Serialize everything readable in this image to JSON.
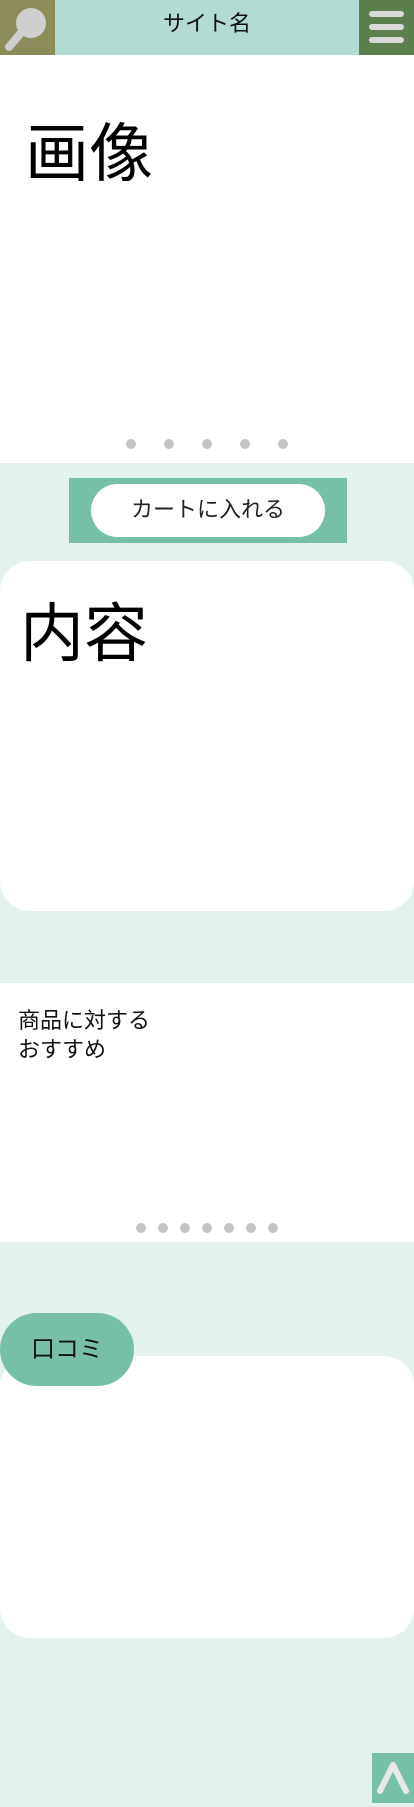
{
  "header": {
    "site_name": "サイト名",
    "search_icon": "search-icon",
    "menu_icon": "hamburger-menu-icon"
  },
  "hero": {
    "label": "画像",
    "carousel_dots": 5
  },
  "cart": {
    "button_label": "カートに入れる"
  },
  "content": {
    "label": "内容"
  },
  "recommend": {
    "text": "商品に対する\nおすすめ",
    "carousel_dots": 7
  },
  "reviews": {
    "tab_label": "口コミ"
  },
  "back_to_top": {
    "icon": "chevron-up-icon"
  },
  "colors": {
    "header_bg": "#b3dbd3",
    "search_bg": "#8b8c5a",
    "menu_bg": "#5d7f50",
    "accent": "#76c0a9",
    "page_bg": "#e3f2ef"
  }
}
